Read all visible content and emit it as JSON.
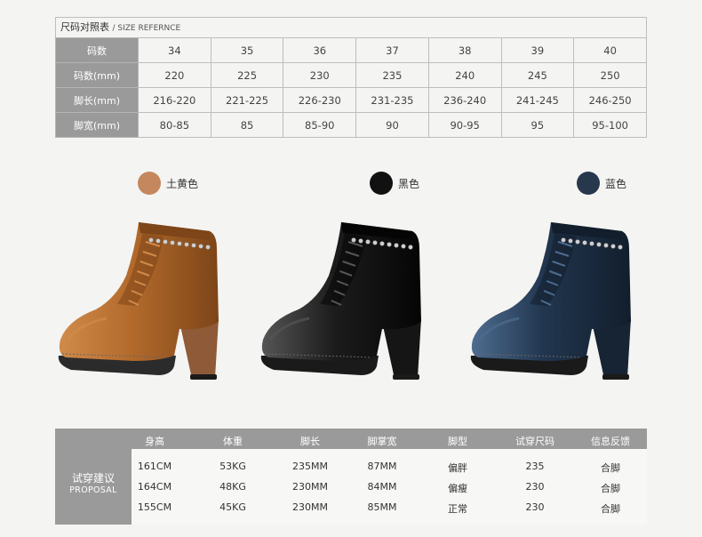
{
  "size_table": {
    "title": "尺码对照表",
    "title_en": "/ SIZE REFERNCE",
    "rows": [
      {
        "label": "码数",
        "values": [
          "34",
          "35",
          "36",
          "37",
          "38",
          "39",
          "40"
        ]
      },
      {
        "label": "码数(mm)",
        "values": [
          "220",
          "225",
          "230",
          "235",
          "240",
          "245",
          "250"
        ]
      },
      {
        "label": "脚长(mm)",
        "values": [
          "216-220",
          "221-225",
          "226-230",
          "231-235",
          "236-240",
          "241-245",
          "246-250"
        ]
      },
      {
        "label": "脚宽(mm)",
        "values": [
          "80-85",
          "85",
          "85-90",
          "90",
          "90-95",
          "95",
          "95-100"
        ]
      }
    ]
  },
  "colors": [
    {
      "label": "土黄色",
      "hex": "#c4875e"
    },
    {
      "label": "黑色",
      "hex": "#111111"
    },
    {
      "label": "蓝色",
      "hex": "#27384d"
    }
  ],
  "boots": [
    {
      "name": "tan",
      "main": "#b36a2c",
      "dark": "#7d4518",
      "light": "#d08a4a",
      "heel": "#8f5a38",
      "sole": "#2b2b2b"
    },
    {
      "name": "black",
      "main": "#1c1c1c",
      "dark": "#050505",
      "light": "#555555",
      "heel": "#151515",
      "sole": "#1a1a1a"
    },
    {
      "name": "blue",
      "main": "#22364f",
      "dark": "#121e2c",
      "light": "#4d6c8f",
      "heel": "#172433",
      "sole": "#1a1a1a"
    }
  ],
  "proposal": {
    "side_cn": "试穿建议",
    "side_en": "PROPOSAL",
    "headers": [
      "身高",
      "体重",
      "脚长",
      "脚掌宽",
      "脚型",
      "试穿尺码",
      "信息反馈"
    ],
    "rows": [
      [
        "161CM",
        "53KG",
        "235MM",
        "87MM",
        "偏胖",
        "235",
        "合脚"
      ],
      [
        "164CM",
        "48KG",
        "230MM",
        "84MM",
        "偏瘦",
        "230",
        "合脚"
      ],
      [
        "155CM",
        "45KG",
        "230MM",
        "85MM",
        "正常",
        "230",
        "合脚"
      ]
    ]
  }
}
